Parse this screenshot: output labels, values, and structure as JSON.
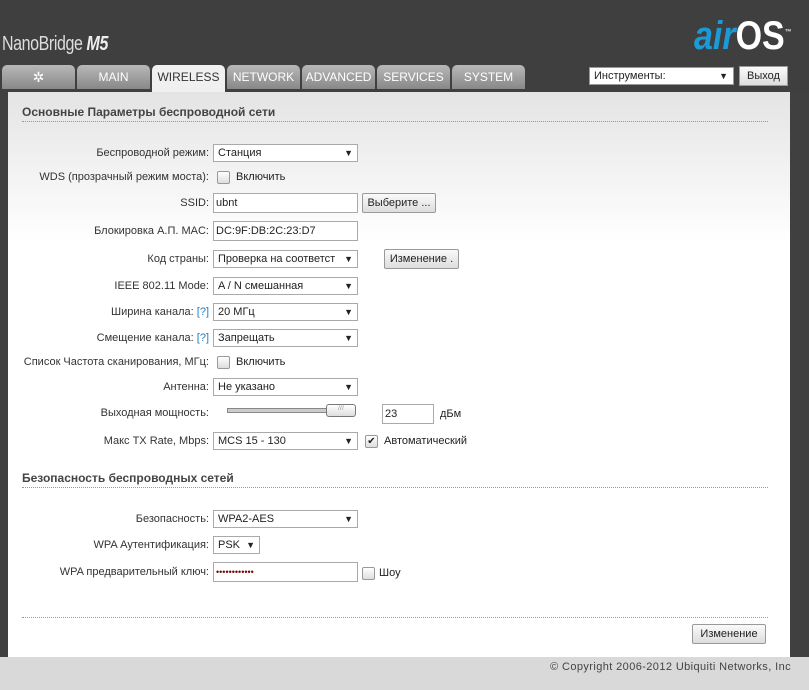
{
  "header": {
    "product": "NanoBridge",
    "model": "M5",
    "logo_air": "air",
    "logo_os": "OS",
    "logo_tm": "™"
  },
  "tabs": [
    {
      "label": ""
    },
    {
      "label": "MAIN"
    },
    {
      "label": "WIRELESS"
    },
    {
      "label": "NETWORK"
    },
    {
      "label": "ADVANCED"
    },
    {
      "label": "SERVICES"
    },
    {
      "label": "SYSTEM"
    }
  ],
  "tools": {
    "selected": "Инструменты:",
    "logout": "Выход"
  },
  "basic": {
    "title": "Основные Параметры беспроводной сети",
    "mode_label": "Беспроводной режим:",
    "mode": "Станция",
    "wds_label": "WDS (прозрачный режим моста):",
    "wds_text": "Включить",
    "ssid_label": "SSID:",
    "ssid": "ubnt",
    "ssid_btn": "Выберите ...",
    "mac_label": "Блокировка А.П. MAC:",
    "mac": "DC:9F:DB:2C:23:D7",
    "country_label": "Код страны:",
    "country": "Проверка на соответст",
    "country_btn": "Изменение .",
    "ieee_label": "IEEE 802.11 Mode:",
    "ieee": "A / N смешанная",
    "width_label": "Ширина канала:",
    "help": "[?]",
    "width": "20 МГц",
    "shift_label": "Смещение канала:",
    "shift": "Запрещать",
    "scan_label": "Список Частота сканирования, МГц:",
    "scan_text": "Включить",
    "antenna_label": "Антенна:",
    "antenna": "Не указано",
    "power_label": "Выходная мощность:",
    "power": "23",
    "power_unit": "дБм",
    "power_fraction": 1.0,
    "tx_label": "Макс TX Rate, Mbps:",
    "tx": "MCS 15 - 130",
    "tx_auto": "Автоматический"
  },
  "security": {
    "title": "Безопасность беспроводных сетей",
    "sec_label": "Безопасность:",
    "sec": "WPA2-AES",
    "auth_label": "WPA Аутентификация:",
    "auth": "PSK",
    "key_label": "WPA предварительный ключ:",
    "key": "••••••••••••",
    "show": "Шоу"
  },
  "apply": "Изменение",
  "footer": "© Copyright 2006-2012 Ubiquiti Networks, Inc"
}
